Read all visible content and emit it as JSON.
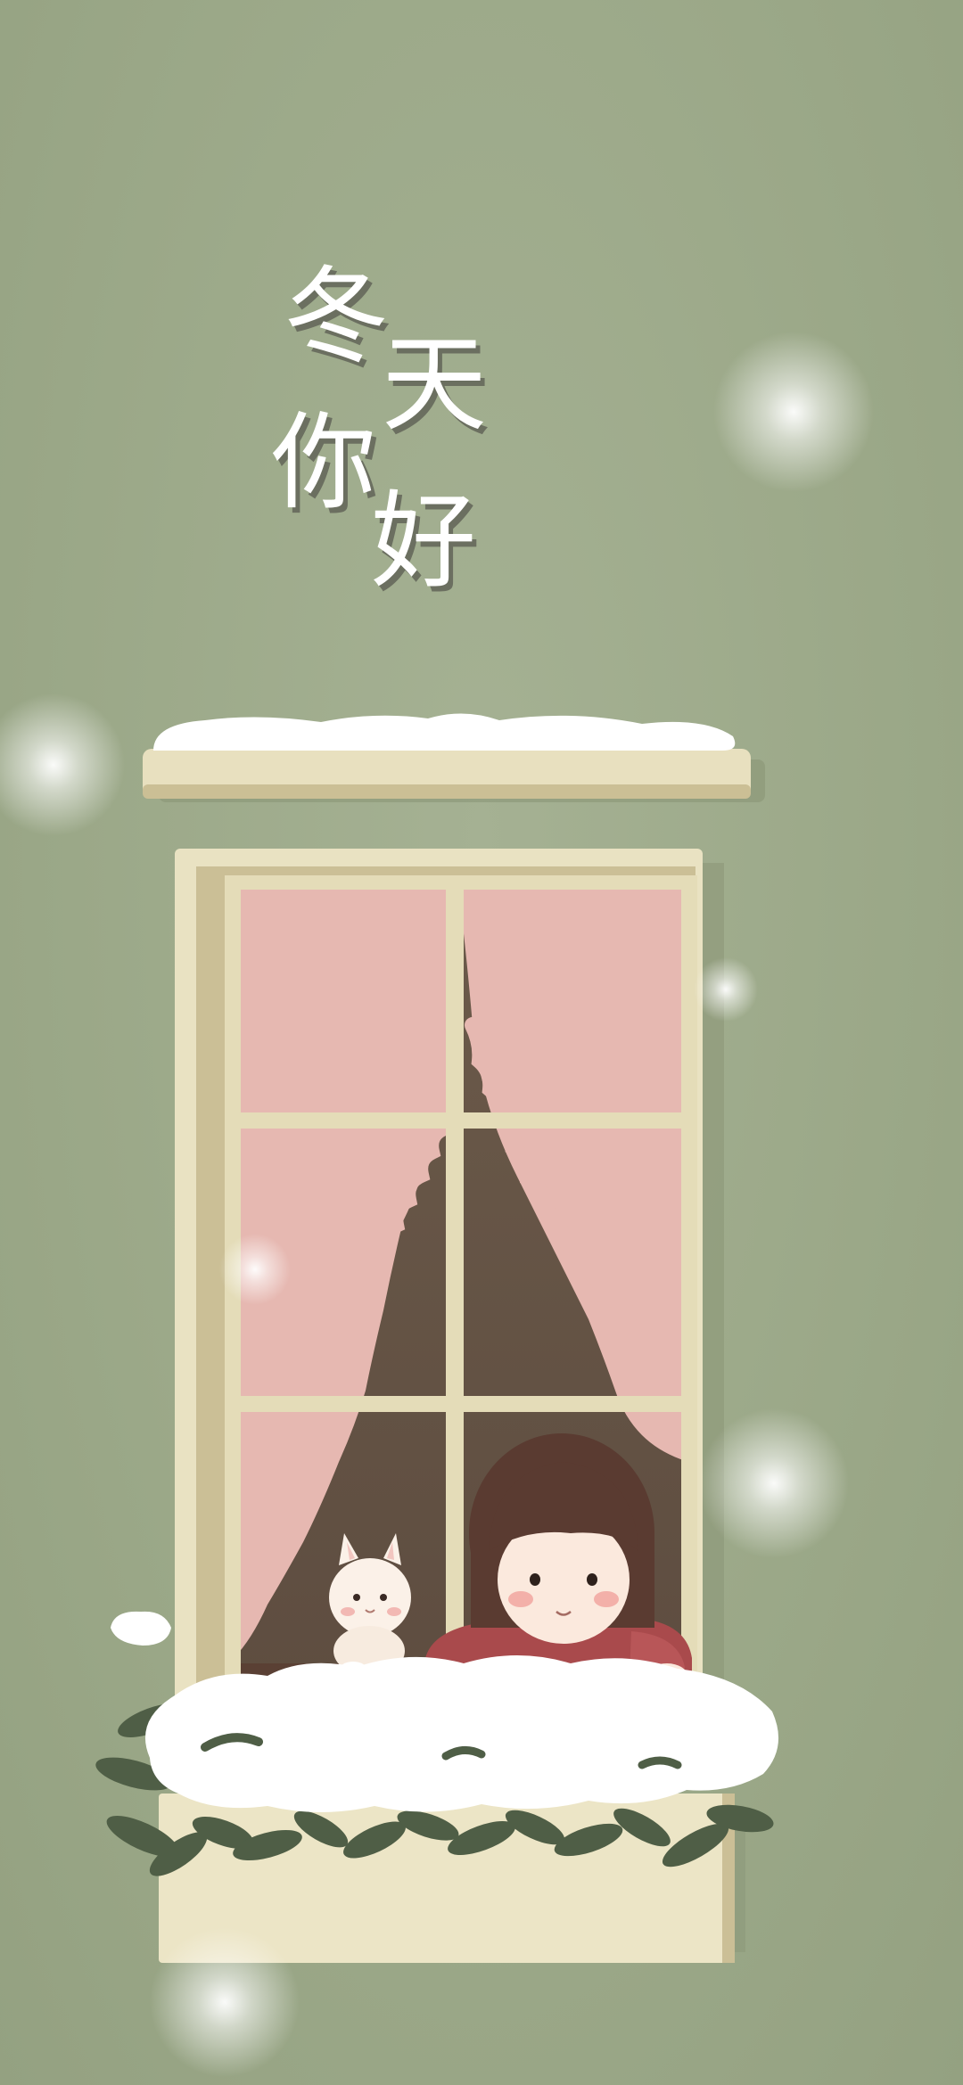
{
  "title": {
    "chars": [
      "冬",
      "天",
      "你",
      "好"
    ]
  },
  "colors": {
    "background": "#9ba888",
    "frame": "#e9e2c2",
    "frame_shadow": "#c9bf98",
    "curtain": "#e6b8b1",
    "room": "#705e4f",
    "snow": "#ffffff",
    "leaves": "#4f5e46",
    "sweater": "#a94a4c",
    "hair": "#5a3b31",
    "skin": "#fbe9dd"
  },
  "scene": {
    "subjects": [
      "girl-at-window",
      "white-cat",
      "snowy-window-box",
      "falling-snow"
    ]
  }
}
